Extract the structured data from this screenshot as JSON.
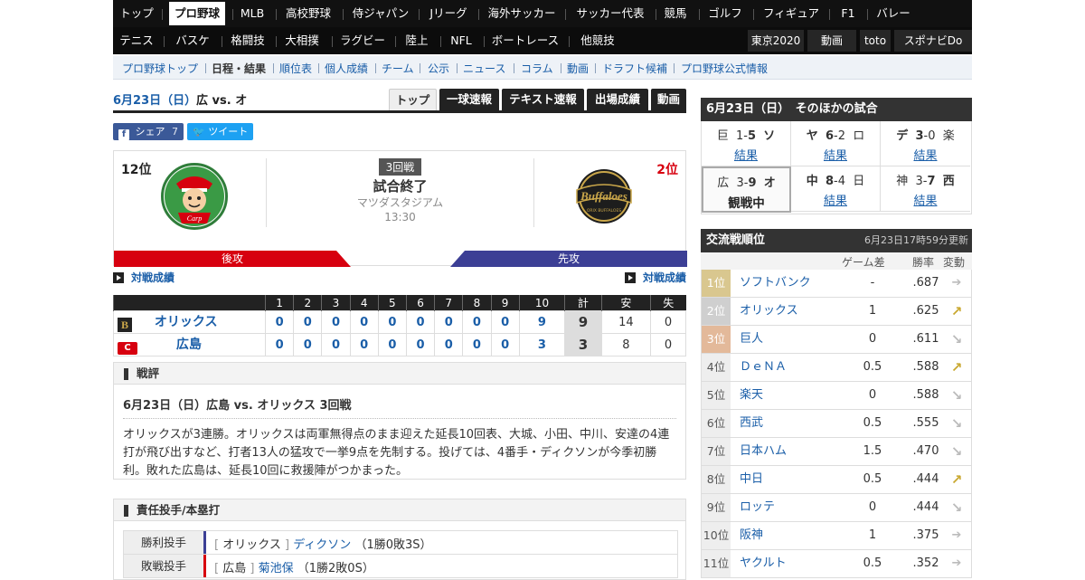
{
  "nav": {
    "row1": [
      "トップ",
      "プロ野球",
      "MLB",
      "高校野球",
      "侍ジャパン",
      "Jリーグ",
      "海外サッカー",
      "サッカー代表",
      "競馬",
      "ゴルフ",
      "フィギュア",
      "F1",
      "バレー"
    ],
    "row2": [
      "テニス",
      "バスケ",
      "格闘技",
      "大相撲",
      "ラグビー",
      "陸上",
      "NFL",
      "ボートレース",
      "他競技"
    ],
    "row2_right": [
      "東京2020",
      "動画",
      "toto",
      "スポナビDo"
    ]
  },
  "subnav": [
    "プロ野球トップ",
    "日程・結果",
    "順位表",
    "個人成績",
    "チーム",
    "公示",
    "ニュース",
    "コラム",
    "動画",
    "ドラフト候補",
    "プロ野球公式情報"
  ],
  "game": {
    "date": "6月23日（日）",
    "matchup": "広 vs. オ",
    "tabs": [
      "トップ",
      "一球速報",
      "テキスト速報",
      "出場成績",
      "動画"
    ],
    "share_label": "シェア",
    "share_count": "7",
    "tweet_label": "ツイート",
    "home_rank": "12位",
    "away_rank": "2位",
    "round": "3回戦",
    "status": "試合終了",
    "venue": "マツダスタジアム",
    "time": "13:30",
    "home_order": "後攻",
    "away_order": "先攻",
    "record_link": "対戦成績"
  },
  "scoreboard": {
    "headers": [
      "1",
      "2",
      "3",
      "4",
      "5",
      "6",
      "7",
      "8",
      "9",
      "10",
      "計",
      "安",
      "失"
    ],
    "rows": [
      {
        "team": "オリックス",
        "innings": [
          "0",
          "0",
          "0",
          "0",
          "0",
          "0",
          "0",
          "0",
          "0",
          "9"
        ],
        "total": "9",
        "hits": "14",
        "errors": "0"
      },
      {
        "team": "広島",
        "innings": [
          "0",
          "0",
          "0",
          "0",
          "0",
          "0",
          "0",
          "0",
          "0",
          "3"
        ],
        "total": "3",
        "hits": "8",
        "errors": "0"
      }
    ]
  },
  "review": {
    "title": "戦評",
    "heading": "6月23日（日）広島 vs. オリックス 3回戦",
    "body": "オリックスが3連勝。オリックスは両軍無得点のまま迎えた延長10回表、大城、小田、中川、安達の4連打が飛び出すなど、打者13人の猛攻で一挙9点を先制する。投げては、4番手・ディクソンが今季初勝利。敗れた広島は、延長10回に救援陣がつかまった。"
  },
  "pitchers": {
    "title": "責任投手/本塁打",
    "rows": [
      {
        "label": "勝利投手",
        "team": "オリックス",
        "player": "ディクソン",
        "record": "（1勝0敗3S）"
      },
      {
        "label": "敗戦投手",
        "team": "広島",
        "player": "菊池保",
        "record": "（1勝2敗0S）"
      }
    ]
  },
  "other_games": {
    "title": "6月23日（日）　そのほかの試合",
    "games": [
      {
        "t1": "巨",
        "s1": "1",
        "s2": "5",
        "t2": "ソ",
        "link": "結果"
      },
      {
        "t1": "ヤ",
        "s1": "6",
        "s2": "2",
        "t2": "ロ",
        "link": "結果"
      },
      {
        "t1": "デ",
        "s1": "3",
        "s2": "0",
        "t2": "楽",
        "link": "結果"
      },
      {
        "t1": "広",
        "s1": "3",
        "s2": "9",
        "t2": "オ",
        "link": "観戦中"
      },
      {
        "t1": "中",
        "s1": "8",
        "s2": "4",
        "t2": "日",
        "link": "結果"
      },
      {
        "t1": "神",
        "s1": "3",
        "s2": "7",
        "t2": "西",
        "link": "結果"
      }
    ]
  },
  "standings": {
    "title": "交流戦順位",
    "updated": "6月23日17時59分更新",
    "cols": [
      "ゲーム差",
      "勝率",
      "変動"
    ],
    "rows": [
      {
        "rank": "1位",
        "team": "ソフトバンク",
        "gb": "-",
        "pct": ".687",
        "trend": "flat"
      },
      {
        "rank": "2位",
        "team": "オリックス",
        "gb": "1",
        "pct": ".625",
        "trend": "up"
      },
      {
        "rank": "3位",
        "team": "巨人",
        "gb": "0",
        "pct": ".611",
        "trend": "down"
      },
      {
        "rank": "4位",
        "team": "ＤｅＮＡ",
        "gb": "0.5",
        "pct": ".588",
        "trend": "up"
      },
      {
        "rank": "5位",
        "team": "楽天",
        "gb": "0",
        "pct": ".588",
        "trend": "down"
      },
      {
        "rank": "6位",
        "team": "西武",
        "gb": "0.5",
        "pct": ".555",
        "trend": "down"
      },
      {
        "rank": "7位",
        "team": "日本ハム",
        "gb": "1.5",
        "pct": ".470",
        "trend": "down"
      },
      {
        "rank": "8位",
        "team": "中日",
        "gb": "0.5",
        "pct": ".444",
        "trend": "up"
      },
      {
        "rank": "9位",
        "team": "ロッテ",
        "gb": "0",
        "pct": ".444",
        "trend": "down"
      },
      {
        "rank": "10位",
        "team": "阪神",
        "gb": "1",
        "pct": ".375",
        "trend": "flat"
      },
      {
        "rank": "11位",
        "team": "ヤクルト",
        "gb": "0.5",
        "pct": ".352",
        "trend": "flat"
      }
    ]
  },
  "colors": {
    "carp_red": "#d7000f",
    "buffaloes_navy": "#3c3f95",
    "link_blue": "#1a5ea8",
    "gold": "#d9c78f",
    "silver": "#cfcfcf",
    "bronze": "#e3b99a"
  }
}
